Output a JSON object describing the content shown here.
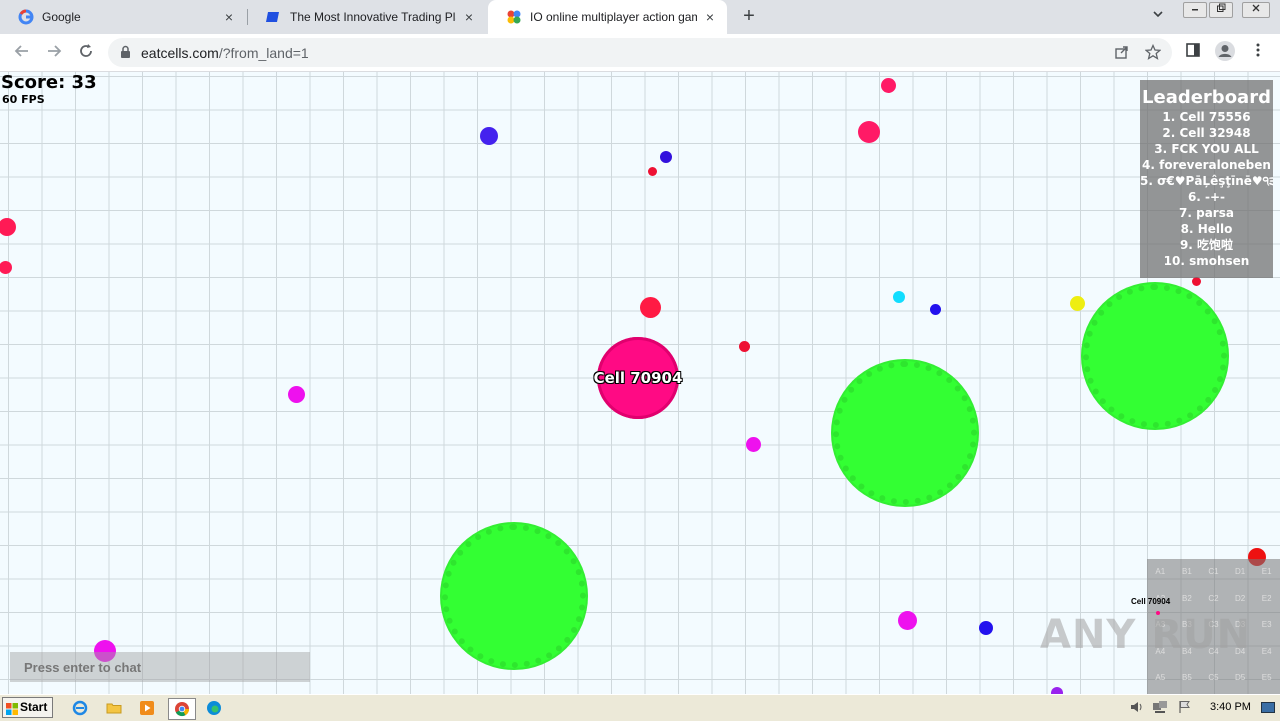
{
  "browser": {
    "tabs": [
      {
        "title": "Google",
        "icon": "google-g-icon",
        "active": false
      },
      {
        "title": "The Most Innovative Trading Platform",
        "icon": "trading-platform-icon",
        "active": false
      },
      {
        "title": "IO online multiplayer action game. Sh",
        "icon": "eatcells-icon",
        "active": true
      }
    ],
    "url_host": "eatcells.com",
    "url_path": "/?from_land=1",
    "new_tab": "+",
    "close": "×"
  },
  "game": {
    "score_text": "Score: 33",
    "fps_text": "60 FPS",
    "player_name": "Cell 70904",
    "player_color": "#ff0a84",
    "leaderboard_title": "Leaderboard",
    "leaderboard": [
      "1. Cell 75556",
      "2. Cell 32948",
      "3. FCK YOU ALL",
      "4. foreveraloneben",
      "5. σ€♥PāĻêşţīnē♥੧੩",
      "6. -+-",
      "7. parsa",
      "8. Hello",
      "9. 吃饱啦",
      "10. smohsen"
    ],
    "chat_placeholder": "Press enter to chat",
    "minimap": {
      "rows": [
        [
          "A1",
          "B1",
          "C1",
          "D1",
          "E1"
        ],
        [
          "A2",
          "B2",
          "C2",
          "D2",
          "E2"
        ],
        [
          "A3",
          "B3",
          "C3",
          "D3",
          "E3"
        ],
        [
          "A4",
          "B4",
          "C4",
          "D4",
          "E4"
        ],
        [
          "A5",
          "B5",
          "C5",
          "D5",
          "E5"
        ]
      ],
      "player_label": "Cell 70904"
    },
    "watermark": "ANY RUN",
    "virus_color": "#33ff33"
  },
  "taskbar": {
    "start_label": "Start",
    "apps": [
      "ie-icon",
      "folder-icon",
      "media-player-icon",
      "chrome-icon",
      "edge-icon"
    ],
    "clock": "3:40 PM"
  }
}
